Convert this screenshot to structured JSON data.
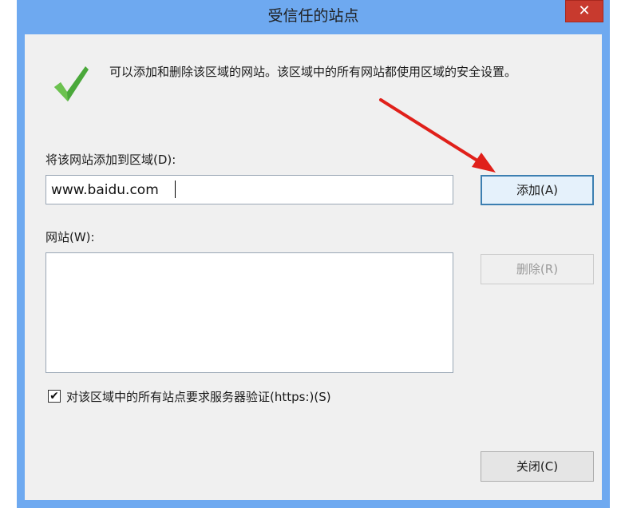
{
  "window": {
    "title": "受信任的站点",
    "close_symbol": "✕"
  },
  "info": {
    "icon": "green-checkmark-icon",
    "text": "可以添加和删除该区域的网站。该区域中的所有网站都使用区域的安全设置。"
  },
  "add_section": {
    "label": "将该网站添加到区域(D):",
    "input_value": "www.baidu.com",
    "add_button": "添加(A)"
  },
  "sites_section": {
    "label": "网站(W):",
    "items": [],
    "remove_button": "删除(R)"
  },
  "https_option": {
    "checked": true,
    "check_mark": "✔",
    "label": "对该区域中的所有站点要求服务器验证(https:)(S)"
  },
  "footer": {
    "close_button": "关闭(C)"
  },
  "colors": {
    "frame": "#6ea9f0",
    "client_bg": "#f0f0f0",
    "close_button_bg": "#c83a2e",
    "annotation_arrow": "#e0201a",
    "check_green": "#4aa83a"
  }
}
